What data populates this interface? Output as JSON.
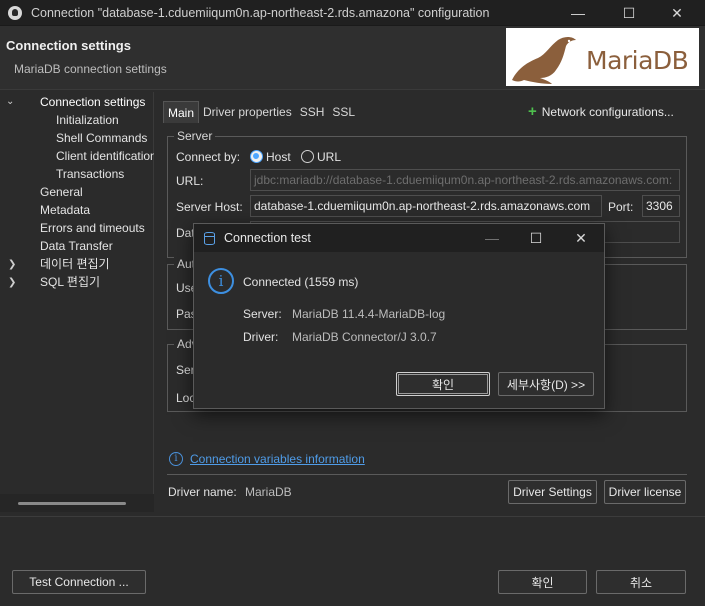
{
  "window": {
    "title": "Connection \"database-1.cduemiiqum0n.ap-northeast-2.rds.amazona\" configuration",
    "minimize": "—",
    "maximize": "☐",
    "close": "✕"
  },
  "header": {
    "title": "Connection settings",
    "subtitle": "MariaDB connection settings",
    "logo_text": "MariaDB"
  },
  "tree": {
    "items": [
      {
        "label": "Connection settings",
        "twisty": "❯"
      },
      {
        "label": "Initialization"
      },
      {
        "label": "Shell Commands"
      },
      {
        "label": "Client identification"
      },
      {
        "label": "Transactions"
      },
      {
        "label": "General"
      },
      {
        "label": "Metadata"
      },
      {
        "label": "Errors and timeouts"
      },
      {
        "label": "Data Transfer"
      },
      {
        "label": "데이터 편집기",
        "twisty": "❯"
      },
      {
        "label": "SQL 편집기",
        "twisty": "❯"
      }
    ]
  },
  "tabs": [
    "Main",
    "Driver properties",
    "SSH",
    "SSL"
  ],
  "network_config": "Network configurations...",
  "server": {
    "legend": "Server",
    "connect_by": "Connect by:",
    "opt_host": "Host",
    "opt_url": "URL",
    "url_label": "URL:",
    "url_value": "jdbc:mariadb://database-1.cduemiiqum0n.ap-northeast-2.rds.amazonaws.com:",
    "host_label": "Server Host:",
    "host_value": "database-1.cduemiiqum0n.ap-northeast-2.rds.amazonaws.com",
    "port_label": "Port:",
    "port_value": "3306",
    "db_label": "Dat"
  },
  "auth": {
    "legend": "Aut",
    "user_label": "Use",
    "pass_label": "Pas"
  },
  "advanced": {
    "legend": "Adv",
    "server_label": "Ser",
    "local_label": "Loc"
  },
  "conn_vars_link": "Connection variables information",
  "driver": {
    "name_label": "Driver name:",
    "name_value": "MariaDB",
    "settings_btn": "Driver Settings",
    "license_btn": "Driver license"
  },
  "footer": {
    "test_btn": "Test Connection ...",
    "ok_btn": "확인",
    "cancel_btn": "취소"
  },
  "dialog": {
    "title": "Connection test",
    "status": "Connected (1559 ms)",
    "server_label": "Server:",
    "server_value": "MariaDB 11.4.4-MariaDB-log",
    "driver_label": "Driver:",
    "driver_value": "MariaDB Connector/J 3.0.7",
    "ok_btn": "확인",
    "details_btn": "세부사항(D) >>"
  },
  "colors": {
    "accent": "#4ea6ff",
    "link": "#4f9ce8",
    "plus": "#4ec04e",
    "logo_brown": "#8b5f3c"
  }
}
